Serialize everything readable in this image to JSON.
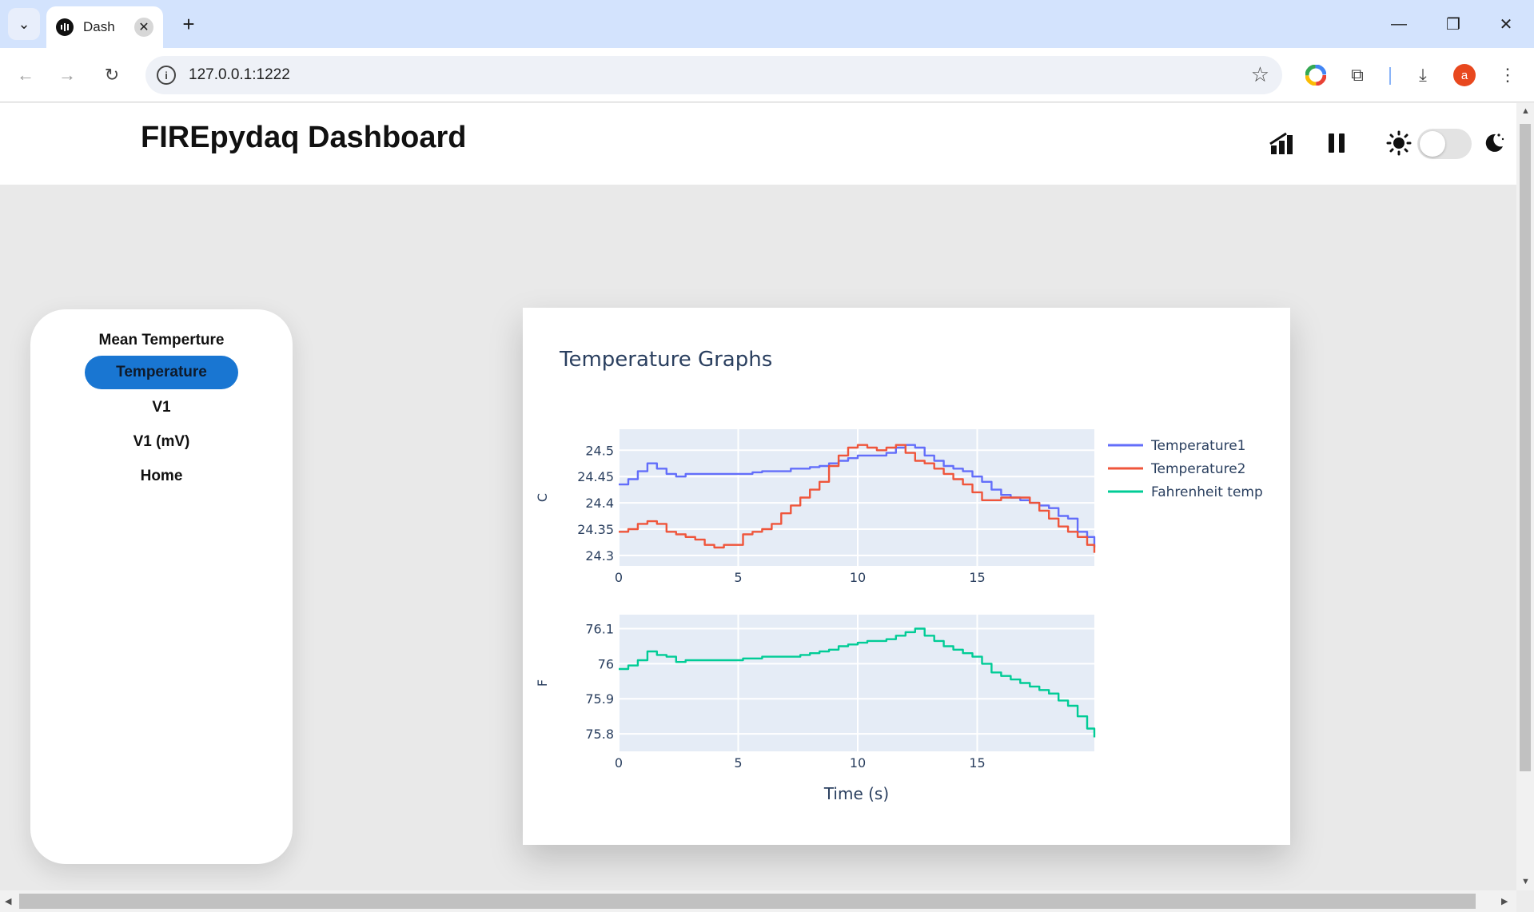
{
  "browser": {
    "tab_title": "Dash",
    "url": "127.0.0.1:1222",
    "avatar_letter": "a"
  },
  "dashboard": {
    "title": "FIREpydaq Dashboard"
  },
  "sidebar": {
    "items": [
      {
        "label": "Mean Temperture",
        "active": false
      },
      {
        "label": "Temperature",
        "active": true
      },
      {
        "label": "V1",
        "active": false
      },
      {
        "label": "V1 (mV)",
        "active": false
      },
      {
        "label": "Home",
        "active": false
      }
    ]
  },
  "graph": {
    "title": "Temperature Graphs"
  },
  "colors": {
    "temperature1": "#636efa",
    "temperature2": "#ef553b",
    "fahrenheit": "#00cc96",
    "plot_bg": "#e5ecf6",
    "active_nav": "#1976d2"
  },
  "chart_data": [
    {
      "type": "line",
      "xlabel": "",
      "ylabel": "C",
      "xlim": [
        0,
        19.9
      ],
      "ylim": [
        24.28,
        24.54
      ],
      "x_ticks": [
        "0",
        "5",
        "10",
        "15"
      ],
      "y_ticks": [
        "24.3",
        "24.35",
        "24.4",
        "24.45",
        "24.5"
      ],
      "legend_position": "right",
      "grid": true,
      "series": [
        {
          "name": "Temperature1",
          "x": [
            0,
            0.4,
            0.8,
            1.2,
            1.6,
            2,
            2.4,
            2.8,
            3.2,
            3.6,
            4,
            4.4,
            4.8,
            5.2,
            5.6,
            6,
            6.4,
            6.8,
            7.2,
            7.6,
            8,
            8.4,
            8.8,
            9.2,
            9.6,
            10,
            10.4,
            10.8,
            11.2,
            11.6,
            12,
            12.4,
            12.8,
            13.2,
            13.6,
            14,
            14.4,
            14.8,
            15.2,
            15.6,
            16,
            16.4,
            16.8,
            17.2,
            17.6,
            18,
            18.4,
            18.8,
            19.2,
            19.6,
            19.9
          ],
          "y": [
            24.435,
            24.445,
            24.46,
            24.475,
            24.465,
            24.455,
            24.45,
            24.455,
            24.455,
            24.455,
            24.455,
            24.455,
            24.455,
            24.455,
            24.458,
            24.46,
            24.46,
            24.46,
            24.465,
            24.465,
            24.468,
            24.47,
            24.475,
            24.48,
            24.485,
            24.49,
            24.49,
            24.49,
            24.495,
            24.505,
            24.51,
            24.505,
            24.49,
            24.48,
            24.47,
            24.465,
            24.46,
            24.45,
            24.44,
            24.425,
            24.415,
            24.41,
            24.405,
            24.4,
            24.395,
            24.39,
            24.375,
            24.37,
            24.345,
            24.335,
            24.315
          ]
        },
        {
          "name": "Temperature2",
          "x": [
            0,
            0.4,
            0.8,
            1.2,
            1.6,
            2,
            2.4,
            2.8,
            3.2,
            3.6,
            4,
            4.4,
            4.8,
            5.2,
            5.6,
            6,
            6.4,
            6.8,
            7.2,
            7.6,
            8,
            8.4,
            8.8,
            9.2,
            9.6,
            10,
            10.4,
            10.8,
            11.2,
            11.6,
            12,
            12.4,
            12.8,
            13.2,
            13.6,
            14,
            14.4,
            14.8,
            15.2,
            15.6,
            16,
            16.4,
            16.8,
            17.2,
            17.6,
            18,
            18.4,
            18.8,
            19.2,
            19.6,
            19.9
          ],
          "y": [
            24.345,
            24.35,
            24.36,
            24.365,
            24.36,
            24.345,
            24.34,
            24.335,
            24.33,
            24.32,
            24.315,
            24.32,
            24.32,
            24.34,
            24.345,
            24.35,
            24.36,
            24.38,
            24.395,
            24.41,
            24.425,
            24.44,
            24.47,
            24.49,
            24.505,
            24.51,
            24.505,
            24.5,
            24.505,
            24.51,
            24.495,
            24.48,
            24.475,
            24.465,
            24.455,
            24.445,
            24.435,
            24.42,
            24.405,
            24.405,
            24.41,
            24.41,
            24.41,
            24.4,
            24.385,
            24.37,
            24.355,
            24.345,
            24.335,
            24.32,
            24.305
          ]
        }
      ]
    },
    {
      "type": "line",
      "xlabel": "Time (s)",
      "ylabel": "F",
      "xlim": [
        0,
        19.9
      ],
      "ylim": [
        75.75,
        76.14
      ],
      "x_ticks": [
        "0",
        "5",
        "10",
        "15"
      ],
      "y_ticks": [
        "75.8",
        "75.9",
        "76",
        "76.1"
      ],
      "grid": true,
      "series": [
        {
          "name": "Fahrenheit temp",
          "x": [
            0,
            0.4,
            0.8,
            1.2,
            1.6,
            2,
            2.4,
            2.8,
            3.2,
            3.6,
            4,
            4.4,
            4.8,
            5.2,
            5.6,
            6,
            6.4,
            6.8,
            7.2,
            7.6,
            8,
            8.4,
            8.8,
            9.2,
            9.6,
            10,
            10.4,
            10.8,
            11.2,
            11.6,
            12,
            12.4,
            12.8,
            13.2,
            13.6,
            14,
            14.4,
            14.8,
            15.2,
            15.6,
            16,
            16.4,
            16.8,
            17.2,
            17.6,
            18,
            18.4,
            18.8,
            19.2,
            19.6,
            19.9
          ],
          "y": [
            75.985,
            75.995,
            76.01,
            76.035,
            76.025,
            76.02,
            76.005,
            76.01,
            76.01,
            76.01,
            76.01,
            76.01,
            76.01,
            76.015,
            76.015,
            76.02,
            76.02,
            76.02,
            76.02,
            76.025,
            76.03,
            76.035,
            76.04,
            76.05,
            76.055,
            76.06,
            76.065,
            76.065,
            76.07,
            76.08,
            76.09,
            76.1,
            76.08,
            76.065,
            76.05,
            76.04,
            76.03,
            76.02,
            76.0,
            75.975,
            75.965,
            75.955,
            75.945,
            75.935,
            75.925,
            75.915,
            75.895,
            75.88,
            75.85,
            75.815,
            75.79
          ]
        }
      ]
    }
  ]
}
